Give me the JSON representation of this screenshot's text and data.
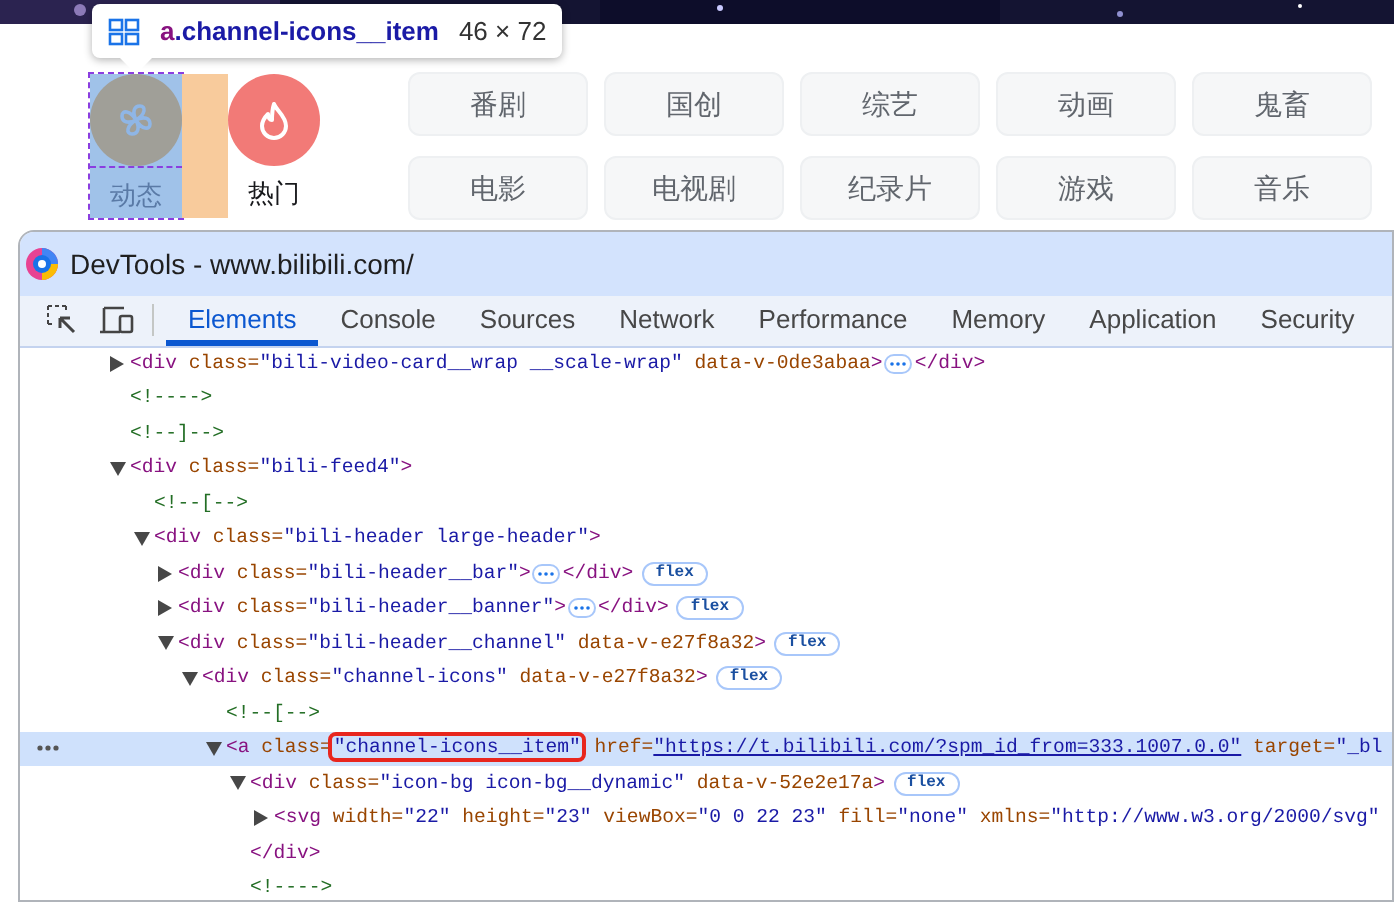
{
  "tooltip": {
    "tag": "a",
    "class_name": ".channel-icons__item",
    "size": "46 × 72"
  },
  "channel_icons": [
    {
      "kind": "dynamic",
      "label": "动态",
      "inspected": true
    },
    {
      "kind": "hot",
      "label": "热门",
      "inspected": false
    }
  ],
  "channels": [
    "番剧",
    "国创",
    "综艺",
    "动画",
    "鬼畜",
    "电影",
    "电视剧",
    "纪录片",
    "游戏",
    "音乐"
  ],
  "devtools": {
    "title": "DevTools - www.bilibili.com/",
    "tabs": [
      {
        "label": "Elements",
        "selected": true
      },
      {
        "label": "Console",
        "selected": false
      },
      {
        "label": "Sources",
        "selected": false
      },
      {
        "label": "Network",
        "selected": false
      },
      {
        "label": "Performance",
        "selected": false
      },
      {
        "label": "Memory",
        "selected": false
      },
      {
        "label": "Application",
        "selected": false
      },
      {
        "label": "Security",
        "selected": false
      }
    ],
    "elements": [
      {
        "selected": false,
        "expanded": false,
        "ellipsis": true,
        "parts": [
          {
            "kind": "tag",
            "text": "<div "
          },
          {
            "kind": "attr",
            "text": "class="
          },
          {
            "kind": "value",
            "text": "\"bili-video-card__wrap __scale-wrap\""
          },
          {
            "kind": "attr",
            "text": " data-v-0de3abaa"
          },
          {
            "kind": "tag",
            "text": ">"
          }
        ],
        "closing": [
          {
            "kind": "tag",
            "text": "</div>"
          }
        ]
      },
      {
        "selected": false,
        "parts": [
          {
            "kind": "comment",
            "text": "<!---->"
          }
        ]
      },
      {
        "selected": false,
        "parts": [
          {
            "kind": "comment",
            "text": "<!--]-->"
          }
        ]
      },
      {
        "selected": false,
        "expanded": true,
        "parts": [
          {
            "kind": "tag",
            "text": "<div "
          },
          {
            "kind": "attr",
            "text": "class="
          },
          {
            "kind": "value",
            "text": "\"bili-feed4\""
          },
          {
            "kind": "tag",
            "text": ">"
          }
        ],
        "children": [
          {
            "selected": false,
            "parts": [
              {
                "kind": "comment",
                "text": "<!--[-->"
              }
            ]
          },
          {
            "selected": false,
            "expanded": true,
            "parts": [
              {
                "kind": "tag",
                "text": "<div "
              },
              {
                "kind": "attr",
                "text": "class="
              },
              {
                "kind": "value",
                "text": "\"bili-header large-header\""
              },
              {
                "kind": "tag",
                "text": ">"
              }
            ],
            "children": [
              {
                "selected": false,
                "expanded": false,
                "ellipsis": true,
                "badge": "flex",
                "parts": [
                  {
                    "kind": "tag",
                    "text": "<div "
                  },
                  {
                    "kind": "attr",
                    "text": "class="
                  },
                  {
                    "kind": "value",
                    "text": "\"bili-header__bar\""
                  },
                  {
                    "kind": "tag",
                    "text": ">"
                  }
                ],
                "closing": [
                  {
                    "kind": "tag",
                    "text": "</div>"
                  }
                ]
              },
              {
                "selected": false,
                "expanded": false,
                "ellipsis": true,
                "badge": "flex",
                "parts": [
                  {
                    "kind": "tag",
                    "text": "<div "
                  },
                  {
                    "kind": "attr",
                    "text": "class="
                  },
                  {
                    "kind": "value",
                    "text": "\"bili-header__banner\""
                  },
                  {
                    "kind": "tag",
                    "text": ">"
                  }
                ],
                "closing": [
                  {
                    "kind": "tag",
                    "text": "</div>"
                  }
                ]
              },
              {
                "selected": false,
                "expanded": true,
                "badge": "flex",
                "parts": [
                  {
                    "kind": "tag",
                    "text": "<div "
                  },
                  {
                    "kind": "attr",
                    "text": "class="
                  },
                  {
                    "kind": "value",
                    "text": "\"bili-header__channel\""
                  },
                  {
                    "kind": "attr",
                    "text": " data-v-e27f8a32"
                  },
                  {
                    "kind": "tag",
                    "text": ">"
                  }
                ],
                "children": [
                  {
                    "selected": false,
                    "expanded": true,
                    "badge": "flex",
                    "parts": [
                      {
                        "kind": "tag",
                        "text": "<div "
                      },
                      {
                        "kind": "attr",
                        "text": "class="
                      },
                      {
                        "kind": "value",
                        "text": "\"channel-icons\""
                      },
                      {
                        "kind": "attr",
                        "text": " data-v-e27f8a32"
                      },
                      {
                        "kind": "tag",
                        "text": ">"
                      }
                    ],
                    "children": [
                      {
                        "selected": false,
                        "parts": [
                          {
                            "kind": "comment",
                            "text": "<!--[-->"
                          }
                        ]
                      },
                      {
                        "selected": true,
                        "expanded": true,
                        "parts": [
                          {
                            "kind": "tag",
                            "text": "<a "
                          },
                          {
                            "kind": "attr",
                            "text": "class="
                          },
                          {
                            "kind": "value",
                            "text": "\"channel-icons__item\"",
                            "boxed": true
                          },
                          {
                            "kind": "attr",
                            "text": " href="
                          },
                          {
                            "kind": "link",
                            "text": "\"https://t.bilibili.com/?spm_id_from=333.1007.0.0\""
                          },
                          {
                            "kind": "attr",
                            "text": " target="
                          },
                          {
                            "kind": "value",
                            "text": "\"_bl"
                          }
                        ],
                        "children": [
                          {
                            "selected": false,
                            "expanded": true,
                            "badge": "flex",
                            "parts": [
                              {
                                "kind": "tag",
                                "text": "<div "
                              },
                              {
                                "kind": "attr",
                                "text": "class="
                              },
                              {
                                "kind": "value",
                                "text": "\"icon-bg icon-bg__dynamic\""
                              },
                              {
                                "kind": "attr",
                                "text": " data-v-52e2e17a"
                              },
                              {
                                "kind": "tag",
                                "text": ">"
                              }
                            ],
                            "children": [
                              {
                                "selected": false,
                                "expanded": false,
                                "parts": [
                                  {
                                    "kind": "tag",
                                    "text": "<svg "
                                  },
                                  {
                                    "kind": "attr",
                                    "text": "width="
                                  },
                                  {
                                    "kind": "value",
                                    "text": "\"22\""
                                  },
                                  {
                                    "kind": "attr",
                                    "text": " height="
                                  },
                                  {
                                    "kind": "value",
                                    "text": "\"23\""
                                  },
                                  {
                                    "kind": "attr",
                                    "text": " viewBox="
                                  },
                                  {
                                    "kind": "value",
                                    "text": "\"0 0 22 23\""
                                  },
                                  {
                                    "kind": "attr",
                                    "text": " fill="
                                  },
                                  {
                                    "kind": "value",
                                    "text": "\"none\""
                                  },
                                  {
                                    "kind": "attr",
                                    "text": " xmlns="
                                  },
                                  {
                                    "kind": "value",
                                    "text": "\"http://www.w3.org/2000/svg\""
                                  }
                                ]
                              }
                            ],
                            "closing": [
                              {
                                "kind": "tag",
                                "text": "</div>"
                              }
                            ]
                          },
                          {
                            "selected": false,
                            "parts": [
                              {
                                "kind": "comment",
                                "text": "<!---->"
                              }
                            ]
                          }
                        ]
                      }
                    ]
                  }
                ]
              }
            ]
          }
        ]
      }
    ]
  }
}
